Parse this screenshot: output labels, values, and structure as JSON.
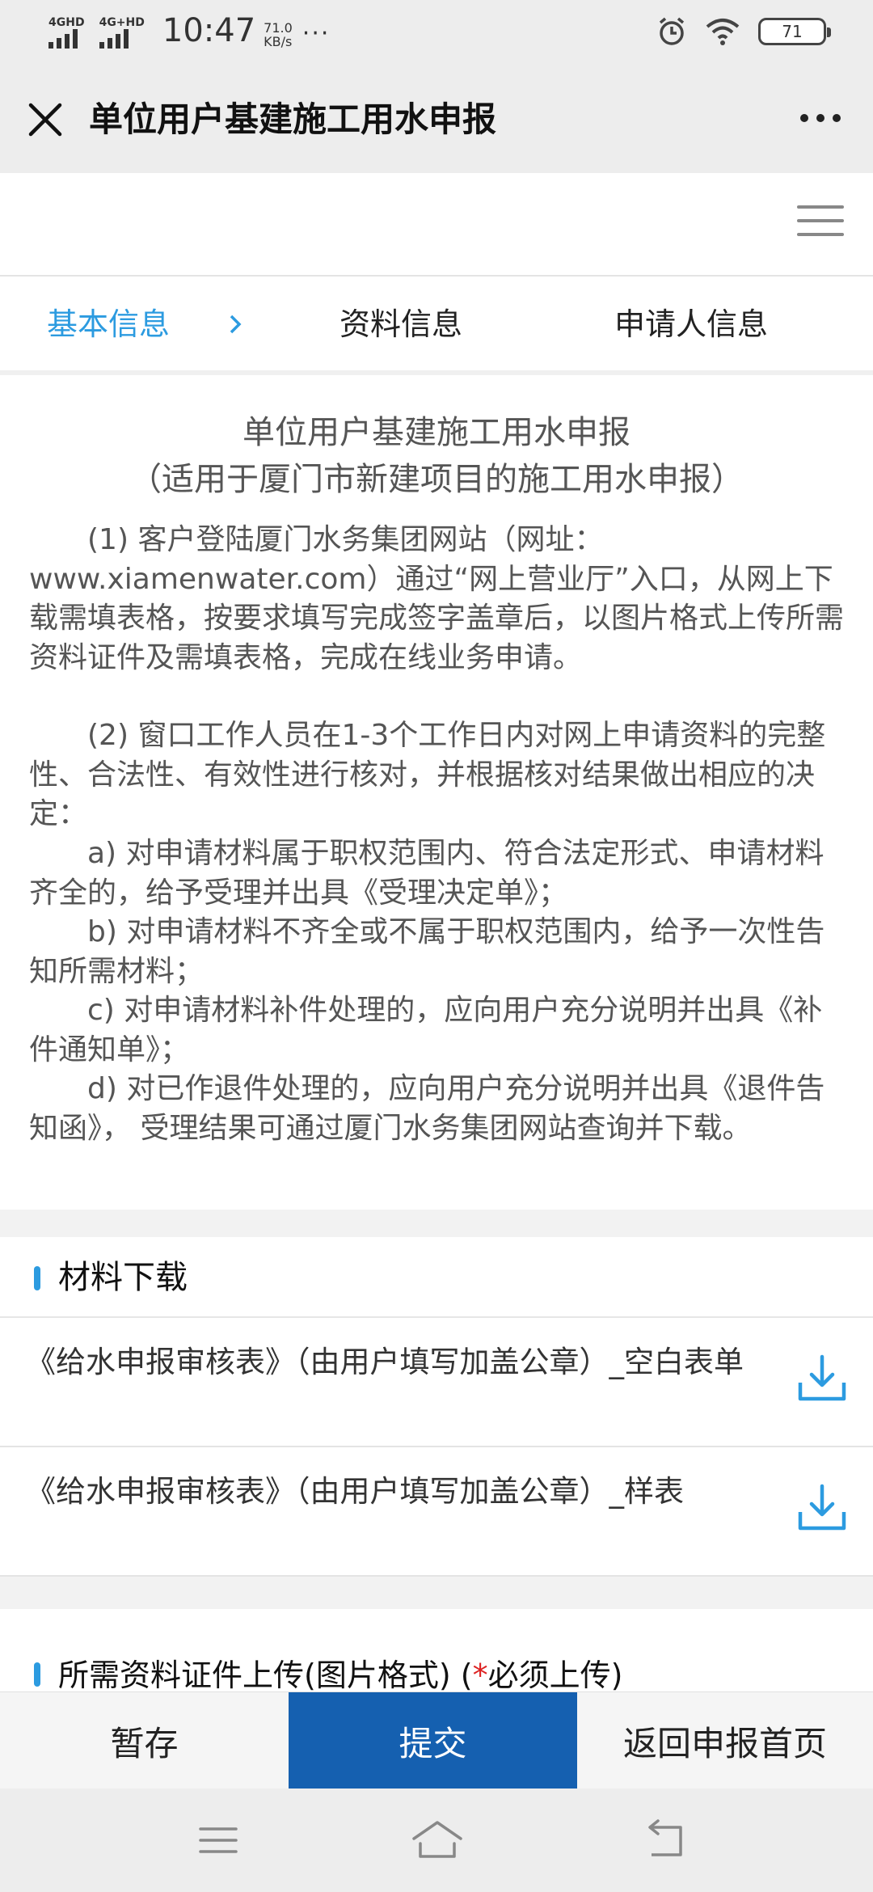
{
  "status_bar": {
    "signal1_label": "4GHD",
    "signal2_label": "4G+HD",
    "time": "10:47",
    "speed_value": "71.0",
    "speed_unit": "KB/s",
    "more_dots": "···",
    "battery": "71"
  },
  "title_bar": {
    "title": "单位用户基建施工用水申报"
  },
  "steps": [
    {
      "label": "基本信息",
      "active": true
    },
    {
      "label": "资料信息",
      "active": false
    },
    {
      "label": "申请人信息",
      "active": false
    }
  ],
  "intro": {
    "title_line1": "单位用户基建施工用水申报",
    "title_line2": "（适用于厦门市新建项目的施工用水申报）",
    "paragraphs": [
      "　　(1) 客户登陆厦门水务集团网站（网址：www.xiamenwater.com）通过“网上营业厅”入口，从网上下载需填表格，按要求填写完成签字盖章后，以图片格式上传所需资料证件及需填表格，完成在线业务申请。",
      "　　(2) 窗口工作人员在1-3个工作日内对网上申请资料的完整性、合法性、有效性进行核对，并根据核对结果做出相应的决定：",
      "　　a) 对申请材料属于职权范围内、符合法定形式、申请材料齐全的，给予受理并出具《受理决定单》；",
      "　　b) 对申请材料不齐全或不属于职权范围内，给予一次性告知所需材料；",
      "　　c) 对申请材料补件处理的，应向用户充分说明并出具《补件通知单》；",
      "　　d) 对已作退件处理的，应向用户充分说明并出具《退件告知函》， 受理结果可通过厦门水务集团网站查询并下载。"
    ]
  },
  "downloads": {
    "section_title": "材料下载",
    "items": [
      {
        "text": "《给水申报审核表》（由用户填写加盖公章）_空白表单"
      },
      {
        "text": "《给水申报审核表》（由用户填写加盖公章）_样表"
      }
    ]
  },
  "uploads": {
    "section_title_prefix": "所需资料证件上传(图片格式) (",
    "required_star": "*",
    "section_title_suffix": "必须上传)"
  },
  "actions": {
    "save_draft": "暂存",
    "submit": "提交",
    "back_home": "返回申报首页"
  },
  "colors": {
    "accent": "#2c9be0",
    "primary_button": "#1560b0",
    "required": "#dd2222"
  }
}
